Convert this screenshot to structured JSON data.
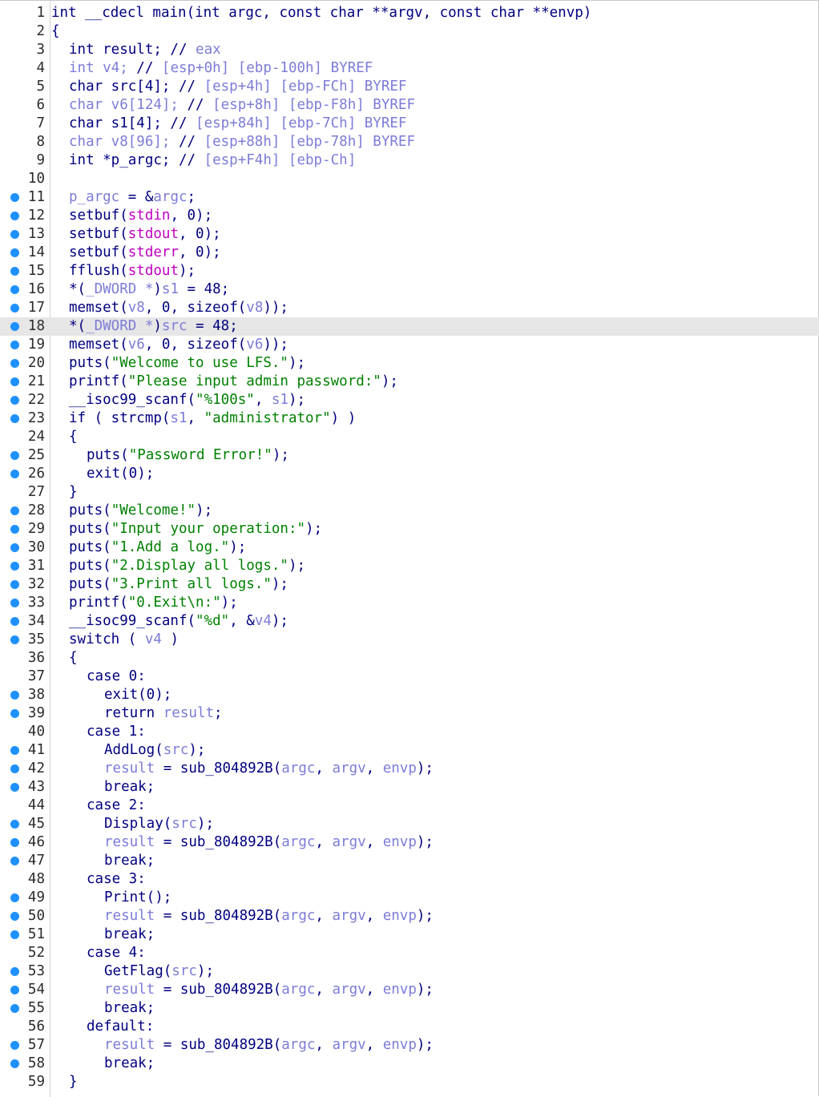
{
  "lines": [
    {
      "n": "1",
      "bp": false,
      "hl": false,
      "indent": 0,
      "parts": [
        [
          "k",
          "int __cdecl main(int argc, const char **argv, const char **envp)"
        ]
      ]
    },
    {
      "n": "2",
      "bp": false,
      "hl": false,
      "indent": 0,
      "parts": [
        [
          "k",
          "{"
        ]
      ]
    },
    {
      "n": "3",
      "bp": false,
      "hl": false,
      "indent": 1,
      "parts": [
        [
          "k",
          "int result; // "
        ],
        [
          "v",
          "eax"
        ]
      ]
    },
    {
      "n": "4",
      "bp": false,
      "hl": false,
      "indent": 1,
      "parts": [
        [
          "v",
          "int v4; "
        ],
        [
          "k",
          "// "
        ],
        [
          "v",
          "[esp+0h] [ebp-100h] BYREF"
        ]
      ]
    },
    {
      "n": "5",
      "bp": false,
      "hl": false,
      "indent": 1,
      "parts": [
        [
          "k",
          "char src[4]; // "
        ],
        [
          "v",
          "[esp+4h] [ebp-FCh] BYREF"
        ]
      ]
    },
    {
      "n": "6",
      "bp": false,
      "hl": false,
      "indent": 1,
      "parts": [
        [
          "v",
          "char v6[124]; "
        ],
        [
          "k",
          "// "
        ],
        [
          "v",
          "[esp+8h] [ebp-F8h] BYREF"
        ]
      ]
    },
    {
      "n": "7",
      "bp": false,
      "hl": false,
      "indent": 1,
      "parts": [
        [
          "k",
          "char s1[4]; // "
        ],
        [
          "v",
          "[esp+84h] [ebp-7Ch] BYREF"
        ]
      ]
    },
    {
      "n": "8",
      "bp": false,
      "hl": false,
      "indent": 1,
      "parts": [
        [
          "v",
          "char v8[96]; "
        ],
        [
          "k",
          "// "
        ],
        [
          "v",
          "[esp+88h] [ebp-78h] BYREF"
        ]
      ]
    },
    {
      "n": "9",
      "bp": false,
      "hl": false,
      "indent": 1,
      "parts": [
        [
          "k",
          "int *p_argc; // "
        ],
        [
          "v",
          "[esp+F4h] [ebp-Ch]"
        ]
      ]
    },
    {
      "n": "10",
      "bp": false,
      "hl": false,
      "indent": 0,
      "parts": []
    },
    {
      "n": "11",
      "bp": true,
      "hl": false,
      "indent": 1,
      "parts": [
        [
          "v",
          "p_argc"
        ],
        [
          "k",
          " = &"
        ],
        [
          "v",
          "argc"
        ],
        [
          "k",
          ";"
        ]
      ]
    },
    {
      "n": "12",
      "bp": true,
      "hl": false,
      "indent": 1,
      "parts": [
        [
          "k",
          "setbuf("
        ],
        [
          "m",
          "stdin"
        ],
        [
          "k",
          ", 0);"
        ]
      ]
    },
    {
      "n": "13",
      "bp": true,
      "hl": false,
      "indent": 1,
      "parts": [
        [
          "k",
          "setbuf("
        ],
        [
          "m",
          "stdout"
        ],
        [
          "k",
          ", 0);"
        ]
      ]
    },
    {
      "n": "14",
      "bp": true,
      "hl": false,
      "indent": 1,
      "parts": [
        [
          "k",
          "setbuf("
        ],
        [
          "m",
          "stderr"
        ],
        [
          "k",
          ", 0);"
        ]
      ]
    },
    {
      "n": "15",
      "bp": true,
      "hl": false,
      "indent": 1,
      "parts": [
        [
          "k",
          "fflush("
        ],
        [
          "m",
          "stdout"
        ],
        [
          "k",
          ");"
        ]
      ]
    },
    {
      "n": "16",
      "bp": true,
      "hl": false,
      "indent": 1,
      "parts": [
        [
          "k",
          "*("
        ],
        [
          "v",
          "_DWORD *"
        ],
        [
          "k",
          ")"
        ],
        [
          "v",
          "s1"
        ],
        [
          "k",
          " = 48;"
        ]
      ]
    },
    {
      "n": "17",
      "bp": true,
      "hl": false,
      "indent": 1,
      "parts": [
        [
          "k",
          "memset("
        ],
        [
          "v",
          "v8"
        ],
        [
          "k",
          ", 0, sizeof("
        ],
        [
          "v",
          "v8"
        ],
        [
          "k",
          "));"
        ]
      ]
    },
    {
      "n": "18",
      "bp": true,
      "hl": true,
      "indent": 1,
      "parts": [
        [
          "k",
          "*("
        ],
        [
          "v",
          "_DWORD *"
        ],
        [
          "k",
          ")"
        ],
        [
          "v",
          "src"
        ],
        [
          "k",
          " = 48;"
        ]
      ]
    },
    {
      "n": "19",
      "bp": true,
      "hl": false,
      "indent": 1,
      "parts": [
        [
          "k",
          "memset("
        ],
        [
          "v",
          "v6"
        ],
        [
          "k",
          ", 0, sizeof("
        ],
        [
          "v",
          "v6"
        ],
        [
          "k",
          "));"
        ]
      ]
    },
    {
      "n": "20",
      "bp": true,
      "hl": false,
      "indent": 1,
      "parts": [
        [
          "k",
          "puts("
        ],
        [
          "s",
          "\"Welcome to use LFS.\""
        ],
        [
          "k",
          ");"
        ]
      ]
    },
    {
      "n": "21",
      "bp": true,
      "hl": false,
      "indent": 1,
      "parts": [
        [
          "k",
          "printf("
        ],
        [
          "s",
          "\"Please input admin password:\""
        ],
        [
          "k",
          ");"
        ]
      ]
    },
    {
      "n": "22",
      "bp": true,
      "hl": false,
      "indent": 1,
      "parts": [
        [
          "k",
          "__isoc99_scanf("
        ],
        [
          "s",
          "\"%100s\""
        ],
        [
          "k",
          ", "
        ],
        [
          "v",
          "s1"
        ],
        [
          "k",
          ");"
        ]
      ]
    },
    {
      "n": "23",
      "bp": true,
      "hl": false,
      "indent": 1,
      "parts": [
        [
          "k",
          "if ( strcmp("
        ],
        [
          "v",
          "s1"
        ],
        [
          "k",
          ", "
        ],
        [
          "s",
          "\"administrator\""
        ],
        [
          "k",
          ") )"
        ]
      ]
    },
    {
      "n": "24",
      "bp": false,
      "hl": false,
      "indent": 1,
      "parts": [
        [
          "k",
          "{"
        ]
      ]
    },
    {
      "n": "25",
      "bp": true,
      "hl": false,
      "indent": 2,
      "parts": [
        [
          "k",
          "puts("
        ],
        [
          "s",
          "\"Password Error!\""
        ],
        [
          "k",
          ");"
        ]
      ]
    },
    {
      "n": "26",
      "bp": true,
      "hl": false,
      "indent": 2,
      "parts": [
        [
          "k",
          "exit(0);"
        ]
      ]
    },
    {
      "n": "27",
      "bp": false,
      "hl": false,
      "indent": 1,
      "parts": [
        [
          "k",
          "}"
        ]
      ]
    },
    {
      "n": "28",
      "bp": true,
      "hl": false,
      "indent": 1,
      "parts": [
        [
          "k",
          "puts("
        ],
        [
          "s",
          "\"Welcome!\""
        ],
        [
          "k",
          ");"
        ]
      ]
    },
    {
      "n": "29",
      "bp": true,
      "hl": false,
      "indent": 1,
      "parts": [
        [
          "k",
          "puts("
        ],
        [
          "s",
          "\"Input your operation:\""
        ],
        [
          "k",
          ");"
        ]
      ]
    },
    {
      "n": "30",
      "bp": true,
      "hl": false,
      "indent": 1,
      "parts": [
        [
          "k",
          "puts("
        ],
        [
          "s",
          "\"1.Add a log.\""
        ],
        [
          "k",
          ");"
        ]
      ]
    },
    {
      "n": "31",
      "bp": true,
      "hl": false,
      "indent": 1,
      "parts": [
        [
          "k",
          "puts("
        ],
        [
          "s",
          "\"2.Display all logs.\""
        ],
        [
          "k",
          ");"
        ]
      ]
    },
    {
      "n": "32",
      "bp": true,
      "hl": false,
      "indent": 1,
      "parts": [
        [
          "k",
          "puts("
        ],
        [
          "s",
          "\"3.Print all logs.\""
        ],
        [
          "k",
          ");"
        ]
      ]
    },
    {
      "n": "33",
      "bp": true,
      "hl": false,
      "indent": 1,
      "parts": [
        [
          "k",
          "printf("
        ],
        [
          "s",
          "\"0.Exit\\n:\""
        ],
        [
          "k",
          ");"
        ]
      ]
    },
    {
      "n": "34",
      "bp": true,
      "hl": false,
      "indent": 1,
      "parts": [
        [
          "k",
          "__isoc99_scanf("
        ],
        [
          "s",
          "\"%d\""
        ],
        [
          "k",
          ", &"
        ],
        [
          "v",
          "v4"
        ],
        [
          "k",
          ");"
        ]
      ]
    },
    {
      "n": "35",
      "bp": true,
      "hl": false,
      "indent": 1,
      "parts": [
        [
          "k",
          "switch ( "
        ],
        [
          "v",
          "v4"
        ],
        [
          "k",
          " )"
        ]
      ]
    },
    {
      "n": "36",
      "bp": false,
      "hl": false,
      "indent": 1,
      "parts": [
        [
          "k",
          "{"
        ]
      ]
    },
    {
      "n": "37",
      "bp": false,
      "hl": false,
      "indent": 2,
      "parts": [
        [
          "k",
          "case 0:"
        ]
      ]
    },
    {
      "n": "38",
      "bp": true,
      "hl": false,
      "indent": 3,
      "parts": [
        [
          "k",
          "exit(0);"
        ]
      ]
    },
    {
      "n": "39",
      "bp": true,
      "hl": false,
      "indent": 3,
      "parts": [
        [
          "k",
          "return "
        ],
        [
          "v",
          "result"
        ],
        [
          "k",
          ";"
        ]
      ]
    },
    {
      "n": "40",
      "bp": false,
      "hl": false,
      "indent": 2,
      "parts": [
        [
          "k",
          "case 1:"
        ]
      ]
    },
    {
      "n": "41",
      "bp": true,
      "hl": false,
      "indent": 3,
      "parts": [
        [
          "k",
          "AddLog("
        ],
        [
          "v",
          "src"
        ],
        [
          "k",
          ");"
        ]
      ]
    },
    {
      "n": "42",
      "bp": true,
      "hl": false,
      "indent": 3,
      "parts": [
        [
          "v",
          "result"
        ],
        [
          "k",
          " = sub_804892B("
        ],
        [
          "v",
          "argc"
        ],
        [
          "k",
          ", "
        ],
        [
          "v",
          "argv"
        ],
        [
          "k",
          ", "
        ],
        [
          "v",
          "envp"
        ],
        [
          "k",
          ");"
        ]
      ]
    },
    {
      "n": "43",
      "bp": true,
      "hl": false,
      "indent": 3,
      "parts": [
        [
          "k",
          "break;"
        ]
      ]
    },
    {
      "n": "44",
      "bp": false,
      "hl": false,
      "indent": 2,
      "parts": [
        [
          "k",
          "case 2:"
        ]
      ]
    },
    {
      "n": "45",
      "bp": true,
      "hl": false,
      "indent": 3,
      "parts": [
        [
          "k",
          "Display("
        ],
        [
          "v",
          "src"
        ],
        [
          "k",
          ");"
        ]
      ]
    },
    {
      "n": "46",
      "bp": true,
      "hl": false,
      "indent": 3,
      "parts": [
        [
          "v",
          "result"
        ],
        [
          "k",
          " = sub_804892B("
        ],
        [
          "v",
          "argc"
        ],
        [
          "k",
          ", "
        ],
        [
          "v",
          "argv"
        ],
        [
          "k",
          ", "
        ],
        [
          "v",
          "envp"
        ],
        [
          "k",
          ");"
        ]
      ]
    },
    {
      "n": "47",
      "bp": true,
      "hl": false,
      "indent": 3,
      "parts": [
        [
          "k",
          "break;"
        ]
      ]
    },
    {
      "n": "48",
      "bp": false,
      "hl": false,
      "indent": 2,
      "parts": [
        [
          "k",
          "case 3:"
        ]
      ]
    },
    {
      "n": "49",
      "bp": true,
      "hl": false,
      "indent": 3,
      "parts": [
        [
          "k",
          "Print();"
        ]
      ]
    },
    {
      "n": "50",
      "bp": true,
      "hl": false,
      "indent": 3,
      "parts": [
        [
          "v",
          "result"
        ],
        [
          "k",
          " = sub_804892B("
        ],
        [
          "v",
          "argc"
        ],
        [
          "k",
          ", "
        ],
        [
          "v",
          "argv"
        ],
        [
          "k",
          ", "
        ],
        [
          "v",
          "envp"
        ],
        [
          "k",
          ");"
        ]
      ]
    },
    {
      "n": "51",
      "bp": true,
      "hl": false,
      "indent": 3,
      "parts": [
        [
          "k",
          "break;"
        ]
      ]
    },
    {
      "n": "52",
      "bp": false,
      "hl": false,
      "indent": 2,
      "parts": [
        [
          "k",
          "case 4:"
        ]
      ]
    },
    {
      "n": "53",
      "bp": true,
      "hl": false,
      "indent": 3,
      "parts": [
        [
          "k",
          "GetFlag("
        ],
        [
          "v",
          "src"
        ],
        [
          "k",
          ");"
        ]
      ]
    },
    {
      "n": "54",
      "bp": true,
      "hl": false,
      "indent": 3,
      "parts": [
        [
          "v",
          "result"
        ],
        [
          "k",
          " = sub_804892B("
        ],
        [
          "v",
          "argc"
        ],
        [
          "k",
          ", "
        ],
        [
          "v",
          "argv"
        ],
        [
          "k",
          ", "
        ],
        [
          "v",
          "envp"
        ],
        [
          "k",
          ");"
        ]
      ]
    },
    {
      "n": "55",
      "bp": true,
      "hl": false,
      "indent": 3,
      "parts": [
        [
          "k",
          "break;"
        ]
      ]
    },
    {
      "n": "56",
      "bp": false,
      "hl": false,
      "indent": 2,
      "parts": [
        [
          "k",
          "default:"
        ]
      ]
    },
    {
      "n": "57",
      "bp": true,
      "hl": false,
      "indent": 3,
      "parts": [
        [
          "v",
          "result"
        ],
        [
          "k",
          " = sub_804892B("
        ],
        [
          "v",
          "argc"
        ],
        [
          "k",
          ", "
        ],
        [
          "v",
          "argv"
        ],
        [
          "k",
          ", "
        ],
        [
          "v",
          "envp"
        ],
        [
          "k",
          ");"
        ]
      ]
    },
    {
      "n": "58",
      "bp": true,
      "hl": false,
      "indent": 3,
      "parts": [
        [
          "k",
          "break;"
        ]
      ]
    },
    {
      "n": "59",
      "bp": false,
      "hl": false,
      "indent": 1,
      "parts": [
        [
          "k",
          "}"
        ]
      ]
    }
  ]
}
